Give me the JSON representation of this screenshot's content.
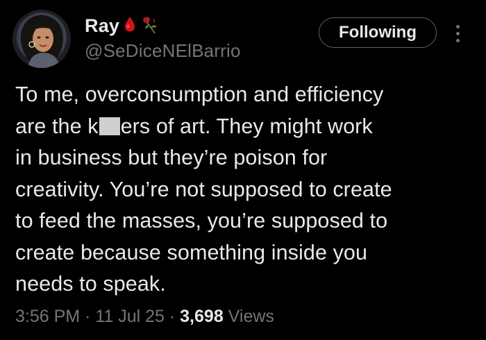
{
  "author": {
    "display_name": "Ray",
    "handle": "@SeDiceNElBarrio",
    "avatar_icon": "avatar-portrait",
    "badges": [
      "blood-drop-icon",
      "wilted-rose-icon"
    ]
  },
  "actions": {
    "follow_label": "Following",
    "more_icon": "more-options-icon"
  },
  "tweet": {
    "lines": [
      {
        "text": "To me, overconsumption and efficiency"
      },
      {
        "pre": "are the k",
        "post": "ers of art. They might work"
      },
      {
        "text": "in business but they’re poison for"
      },
      {
        "text": "creativity. You’re not supposed to create"
      },
      {
        "text": "to feed the masses, you’re supposed to"
      },
      {
        "text": "create because something inside you"
      },
      {
        "text": "needs to speak."
      }
    ]
  },
  "meta": {
    "time": "3:56 PM",
    "sep1": " · ",
    "date": "11 Jul 25",
    "sep2": " · ",
    "views_count": "3,698",
    "views_label": " Views"
  },
  "colors": {
    "background": "#000000",
    "text_primary": "#e7e9ea",
    "text_secondary": "#71767b",
    "blood_drop": "#d1141c"
  }
}
